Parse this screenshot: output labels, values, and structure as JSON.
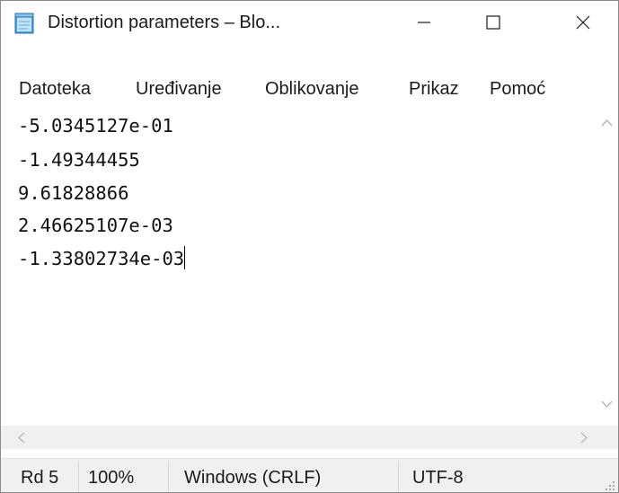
{
  "window": {
    "title": "Distortion parameters – Blo...",
    "icon": "notepad-icon",
    "controls": [
      "minimize-icon",
      "maximize-icon",
      "close-icon"
    ]
  },
  "menu": {
    "items": [
      {
        "label": "Datoteka"
      },
      {
        "label": "Uređivanje"
      },
      {
        "label": "Oblikovanje"
      },
      {
        "label": "Prikaz"
      },
      {
        "label": "Pomoć"
      }
    ]
  },
  "editor": {
    "lines": [
      "-5.0345127e-01",
      "-1.49344455",
      "9.61828866",
      "2.46625107e-03",
      "-1.33802734e-03"
    ]
  },
  "scrollbar_icons": [
    "scroll-up-icon",
    "scroll-down-icon",
    "scroll-left-icon",
    "scroll-right-icon"
  ],
  "status": {
    "position": "Rd 5",
    "zoom": "100%",
    "line_ending": "Windows (CRLF)",
    "encoding": "UTF-8"
  },
  "colors": {
    "status_background": "#f0f0f0",
    "text": "#1a1a1a"
  }
}
